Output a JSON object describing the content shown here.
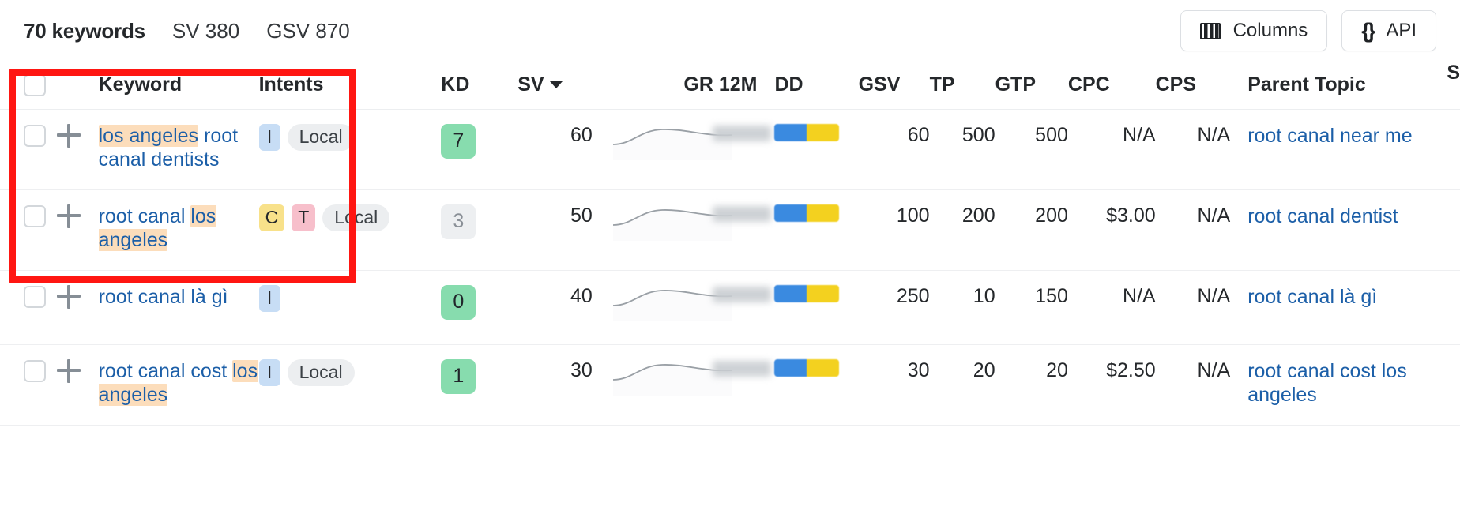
{
  "toolbar": {
    "keywords_count": "70 keywords",
    "sv_summary": "SV 380",
    "gsv_summary": "GSV 870",
    "columns_label": "Columns",
    "api_label": "API",
    "columns_icon": "columns-icon",
    "api_icon": "braces-icon"
  },
  "table": {
    "headers": {
      "keyword": "Keyword",
      "intents": "Intents",
      "kd": "KD",
      "sv": "SV",
      "sv_sort_icon": "caret-down-icon",
      "gr12m": "GR 12M",
      "dd": "DD",
      "gsv": "GSV",
      "tp": "TP",
      "gtp": "GTP",
      "cpc": "CPC",
      "cps": "CPS",
      "parent_topic": "Parent Topic",
      "truncated": "S"
    },
    "rows": [
      {
        "keyword_parts": [
          {
            "text": "los angeles",
            "highlight": true
          },
          {
            "text": " root canal dentists",
            "highlight": false
          }
        ],
        "keyword_plain": "los angeles root canal dentists",
        "intents": [
          {
            "label": "I",
            "type": "informational"
          },
          {
            "label": "Local",
            "type": "local"
          }
        ],
        "kd": "7",
        "kd_color": "green",
        "sv": "60",
        "gr12m": "",
        "dd": "",
        "dd_blue_pct": 50,
        "dd_yellow_pct": 50,
        "gsv": "60",
        "tp": "500",
        "gtp": "500",
        "cpc": "N/A",
        "cps": "N/A",
        "parent_topic": "root canal near me"
      },
      {
        "keyword_parts": [
          {
            "text": "root canal ",
            "highlight": false
          },
          {
            "text": "los angeles",
            "highlight": true
          }
        ],
        "keyword_plain": "root canal los angeles",
        "intents": [
          {
            "label": "C",
            "type": "commercial"
          },
          {
            "label": "T",
            "type": "transactional"
          },
          {
            "label": "Local",
            "type": "local"
          }
        ],
        "kd": "3",
        "kd_color": "grey",
        "sv": "50",
        "gr12m": "",
        "dd": "",
        "dd_blue_pct": 50,
        "dd_yellow_pct": 50,
        "gsv": "100",
        "tp": "200",
        "gtp": "200",
        "cpc": "$3.00",
        "cps": "N/A",
        "parent_topic": "root canal dentist"
      },
      {
        "keyword_parts": [
          {
            "text": "root canal là gì",
            "highlight": false
          }
        ],
        "keyword_plain": "root canal là gì",
        "intents": [
          {
            "label": "I",
            "type": "informational"
          }
        ],
        "kd": "0",
        "kd_color": "green",
        "sv": "40",
        "gr12m": "",
        "dd": "",
        "dd_blue_pct": 50,
        "dd_yellow_pct": 50,
        "gsv": "250",
        "tp": "10",
        "gtp": "150",
        "cpc": "N/A",
        "cps": "N/A",
        "parent_topic": "root canal là gì"
      },
      {
        "keyword_parts": [
          {
            "text": "root canal cost ",
            "highlight": false
          },
          {
            "text": "los angeles",
            "highlight": true
          }
        ],
        "keyword_plain": "root canal cost los angeles",
        "intents": [
          {
            "label": "I",
            "type": "informational"
          },
          {
            "label": "Local",
            "type": "local"
          }
        ],
        "kd": "1",
        "kd_color": "green",
        "sv": "30",
        "gr12m": "",
        "dd": "",
        "dd_blue_pct": 50,
        "dd_yellow_pct": 50,
        "gsv": "30",
        "tp": "20",
        "gtp": "20",
        "cpc": "$2.50",
        "cps": "N/A",
        "parent_topic": "root canal cost los angeles"
      }
    ]
  },
  "annotation": {
    "shape": "rectangle",
    "color": "#ff1612",
    "covers": "keyword-and-intents-columns-first-two-rows"
  },
  "colors": {
    "link": "#1c5fa8",
    "highlight": "#fcddbb",
    "kd_green": "#87dcae",
    "kd_grey": "#edeff1",
    "intent_i": "#c7ddf5",
    "intent_c": "#f8e18a",
    "intent_t": "#f7bfcb",
    "intent_local": "#eceef0",
    "dd_blue": "#3a8ae0",
    "dd_yellow": "#f3d11f",
    "annotation_red": "#ff1612"
  }
}
